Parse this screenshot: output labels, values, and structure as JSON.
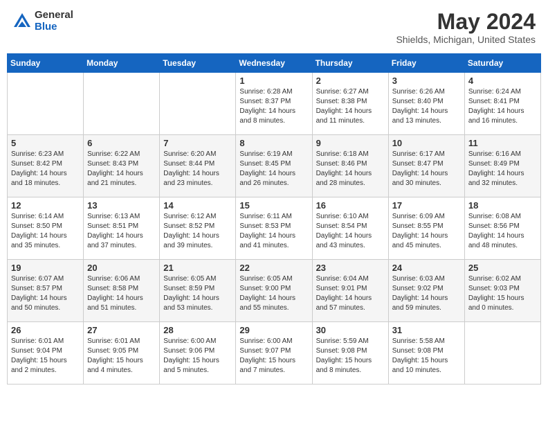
{
  "header": {
    "logo_general": "General",
    "logo_blue": "Blue",
    "month_title": "May 2024",
    "location": "Shields, Michigan, United States"
  },
  "days_of_week": [
    "Sunday",
    "Monday",
    "Tuesday",
    "Wednesday",
    "Thursday",
    "Friday",
    "Saturday"
  ],
  "weeks": [
    {
      "days": [
        {
          "number": "",
          "info": ""
        },
        {
          "number": "",
          "info": ""
        },
        {
          "number": "",
          "info": ""
        },
        {
          "number": "1",
          "info": "Sunrise: 6:28 AM\nSunset: 8:37 PM\nDaylight: 14 hours\nand 8 minutes."
        },
        {
          "number": "2",
          "info": "Sunrise: 6:27 AM\nSunset: 8:38 PM\nDaylight: 14 hours\nand 11 minutes."
        },
        {
          "number": "3",
          "info": "Sunrise: 6:26 AM\nSunset: 8:40 PM\nDaylight: 14 hours\nand 13 minutes."
        },
        {
          "number": "4",
          "info": "Sunrise: 6:24 AM\nSunset: 8:41 PM\nDaylight: 14 hours\nand 16 minutes."
        }
      ]
    },
    {
      "days": [
        {
          "number": "5",
          "info": "Sunrise: 6:23 AM\nSunset: 8:42 PM\nDaylight: 14 hours\nand 18 minutes."
        },
        {
          "number": "6",
          "info": "Sunrise: 6:22 AM\nSunset: 8:43 PM\nDaylight: 14 hours\nand 21 minutes."
        },
        {
          "number": "7",
          "info": "Sunrise: 6:20 AM\nSunset: 8:44 PM\nDaylight: 14 hours\nand 23 minutes."
        },
        {
          "number": "8",
          "info": "Sunrise: 6:19 AM\nSunset: 8:45 PM\nDaylight: 14 hours\nand 26 minutes."
        },
        {
          "number": "9",
          "info": "Sunrise: 6:18 AM\nSunset: 8:46 PM\nDaylight: 14 hours\nand 28 minutes."
        },
        {
          "number": "10",
          "info": "Sunrise: 6:17 AM\nSunset: 8:47 PM\nDaylight: 14 hours\nand 30 minutes."
        },
        {
          "number": "11",
          "info": "Sunrise: 6:16 AM\nSunset: 8:49 PM\nDaylight: 14 hours\nand 32 minutes."
        }
      ]
    },
    {
      "days": [
        {
          "number": "12",
          "info": "Sunrise: 6:14 AM\nSunset: 8:50 PM\nDaylight: 14 hours\nand 35 minutes."
        },
        {
          "number": "13",
          "info": "Sunrise: 6:13 AM\nSunset: 8:51 PM\nDaylight: 14 hours\nand 37 minutes."
        },
        {
          "number": "14",
          "info": "Sunrise: 6:12 AM\nSunset: 8:52 PM\nDaylight: 14 hours\nand 39 minutes."
        },
        {
          "number": "15",
          "info": "Sunrise: 6:11 AM\nSunset: 8:53 PM\nDaylight: 14 hours\nand 41 minutes."
        },
        {
          "number": "16",
          "info": "Sunrise: 6:10 AM\nSunset: 8:54 PM\nDaylight: 14 hours\nand 43 minutes."
        },
        {
          "number": "17",
          "info": "Sunrise: 6:09 AM\nSunset: 8:55 PM\nDaylight: 14 hours\nand 45 minutes."
        },
        {
          "number": "18",
          "info": "Sunrise: 6:08 AM\nSunset: 8:56 PM\nDaylight: 14 hours\nand 48 minutes."
        }
      ]
    },
    {
      "days": [
        {
          "number": "19",
          "info": "Sunrise: 6:07 AM\nSunset: 8:57 PM\nDaylight: 14 hours\nand 50 minutes."
        },
        {
          "number": "20",
          "info": "Sunrise: 6:06 AM\nSunset: 8:58 PM\nDaylight: 14 hours\nand 51 minutes."
        },
        {
          "number": "21",
          "info": "Sunrise: 6:05 AM\nSunset: 8:59 PM\nDaylight: 14 hours\nand 53 minutes."
        },
        {
          "number": "22",
          "info": "Sunrise: 6:05 AM\nSunset: 9:00 PM\nDaylight: 14 hours\nand 55 minutes."
        },
        {
          "number": "23",
          "info": "Sunrise: 6:04 AM\nSunset: 9:01 PM\nDaylight: 14 hours\nand 57 minutes."
        },
        {
          "number": "24",
          "info": "Sunrise: 6:03 AM\nSunset: 9:02 PM\nDaylight: 14 hours\nand 59 minutes."
        },
        {
          "number": "25",
          "info": "Sunrise: 6:02 AM\nSunset: 9:03 PM\nDaylight: 15 hours\nand 0 minutes."
        }
      ]
    },
    {
      "days": [
        {
          "number": "26",
          "info": "Sunrise: 6:01 AM\nSunset: 9:04 PM\nDaylight: 15 hours\nand 2 minutes."
        },
        {
          "number": "27",
          "info": "Sunrise: 6:01 AM\nSunset: 9:05 PM\nDaylight: 15 hours\nand 4 minutes."
        },
        {
          "number": "28",
          "info": "Sunrise: 6:00 AM\nSunset: 9:06 PM\nDaylight: 15 hours\nand 5 minutes."
        },
        {
          "number": "29",
          "info": "Sunrise: 6:00 AM\nSunset: 9:07 PM\nDaylight: 15 hours\nand 7 minutes."
        },
        {
          "number": "30",
          "info": "Sunrise: 5:59 AM\nSunset: 9:08 PM\nDaylight: 15 hours\nand 8 minutes."
        },
        {
          "number": "31",
          "info": "Sunrise: 5:58 AM\nSunset: 9:08 PM\nDaylight: 15 hours\nand 10 minutes."
        },
        {
          "number": "",
          "info": ""
        }
      ]
    }
  ]
}
